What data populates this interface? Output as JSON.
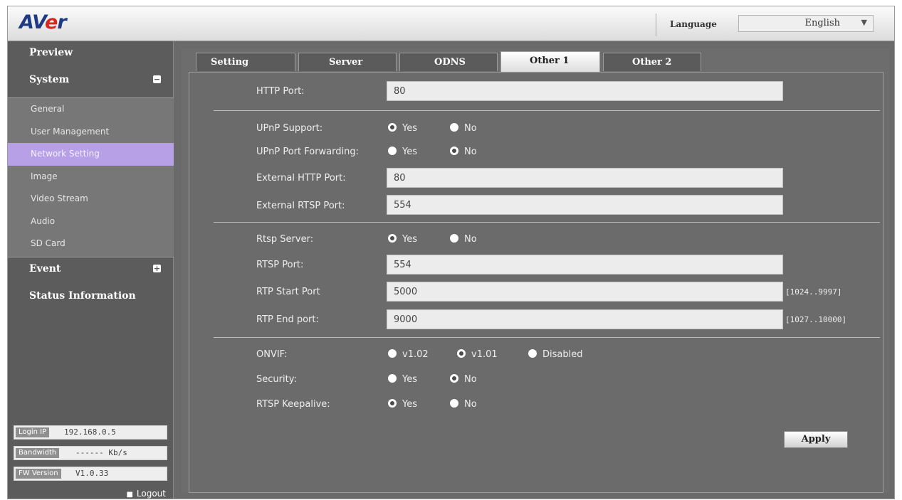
{
  "header": {
    "logo_a": "AV",
    "logo_e": "e",
    "logo_r": "r",
    "language_label": "Language",
    "language_value": "English"
  },
  "sidebar": {
    "preview": "Preview",
    "system": "System",
    "system_toggle": "−",
    "sub_items": [
      "General",
      "User Management",
      "Network Setting",
      "Image",
      "Video Stream",
      "Audio",
      "SD Card"
    ],
    "active_sub": "Network Setting",
    "event": "Event",
    "event_toggle": "+",
    "status_information": "Status Information",
    "login_ip_label": "Login IP",
    "login_ip_value": "192.168.0.5",
    "bandwidth_label": "Bandwidth",
    "bandwidth_value": "------ Kb/s",
    "fw_version_label": "FW Version",
    "fw_version_value": "V1.0.33",
    "logout": "Logout"
  },
  "tabs": [
    "Setting",
    "Server",
    "ODNS",
    "Other 1",
    "Other 2"
  ],
  "active_tab": "Other 1",
  "form": {
    "http_port_label": "HTTP Port:",
    "http_port_value": "80",
    "upnp_support_label": "UPnP Support:",
    "upnp_support": "Yes",
    "upnp_port_forwarding_label": "UPnP Port Forwarding:",
    "upnp_port_forwarding": "No",
    "external_http_port_label": "External HTTP Port:",
    "external_http_port_value": "80",
    "external_rtsp_port_label": "External RTSP Port:",
    "external_rtsp_port_value": "554",
    "rtsp_server_label": "Rtsp Server:",
    "rtsp_server": "Yes",
    "rtsp_port_label": "RTSP Port:",
    "rtsp_port_value": "554",
    "rtp_start_port_label": "RTP Start Port",
    "rtp_start_port_value": "5000",
    "rtp_start_port_range": "[1024..9997]",
    "rtp_end_port_label": "RTP End port:",
    "rtp_end_port_value": "9000",
    "rtp_end_port_range": "[1027..10000]",
    "onvif_label": "ONVIF:",
    "onvif": "v1.01",
    "security_label": "Security:",
    "security": "No",
    "rtsp_keepalive_label": "RTSP Keepalive:",
    "rtsp_keepalive": "Yes",
    "yes": "Yes",
    "no": "No",
    "v102": "v1.02",
    "v101": "v1.01",
    "disabled": "Disabled",
    "apply": "Apply"
  },
  "colors": {
    "active_nav": "#b7a0e6",
    "panel_bg": "#6b6b6b",
    "logo_blue": "#1f3a84",
    "logo_red": "#d8261f"
  }
}
